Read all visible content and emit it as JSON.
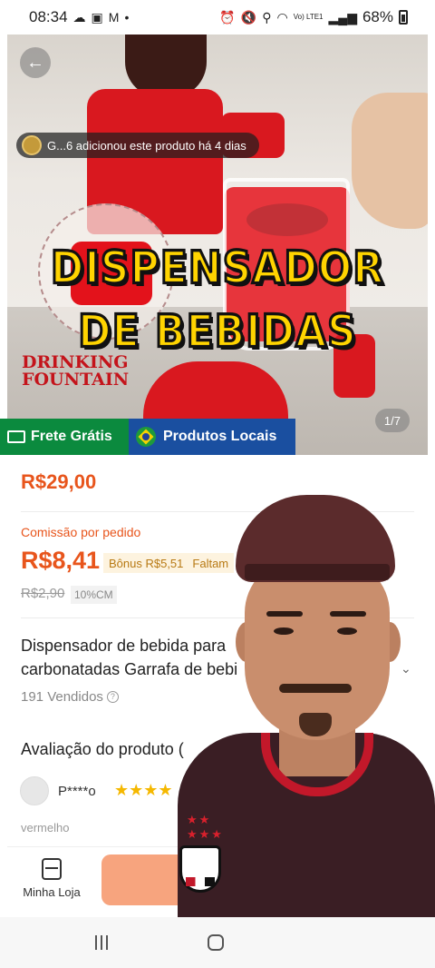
{
  "status_bar": {
    "time": "08:34",
    "battery": "68%",
    "network": "Vo) LTE1"
  },
  "hero": {
    "notification": "G...6 adicionou este produto há 4 dias",
    "overlay_line1": "DISPENSADOR",
    "overlay_line2": "DE BEBIDAS",
    "drinking_line1": "DRINKING",
    "drinking_line2": "FOUNTAIN",
    "image_counter": "1/7"
  },
  "badges": {
    "shipping": "Frete Grátis",
    "local": "Produtos Locais"
  },
  "pricing": {
    "price": "R$29,00",
    "commission_label": "Comissão por pedido",
    "commission_value": "R$8,41",
    "bonus": "Bônus R$5,51",
    "bonus_extra": "Faltam",
    "old_price": "R$2,90",
    "cm_tag": "10%CM"
  },
  "product": {
    "description_line1": "Dispensador de bebida para",
    "description_line2": "carbonatadas Garrafa de bebi",
    "sold": "191 Vendidos"
  },
  "reviews": {
    "title": "Avaliação do produto (",
    "reviewer": "P****o",
    "stars": "★★★★",
    "variant": "vermelho"
  },
  "action_bar": {
    "store_label": "Minha Loja"
  },
  "colors": {
    "accent": "#e8551c",
    "shipping_badge": "#0b8a3e",
    "local_badge": "#1a4fa0",
    "overlay_text": "#ffd400"
  }
}
